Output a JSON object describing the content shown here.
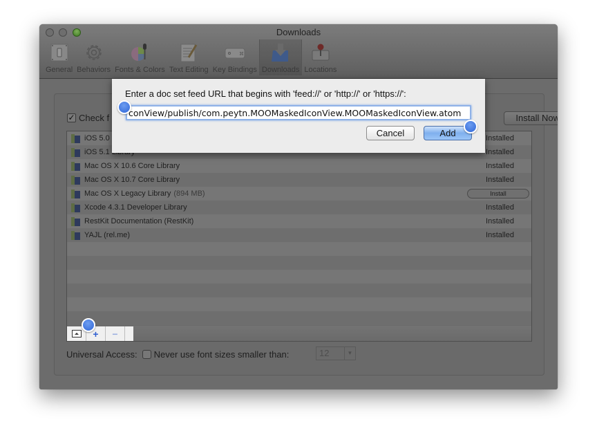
{
  "window": {
    "title": "Downloads",
    "toolbar": [
      {
        "label": "General",
        "icon": "general-switch-icon",
        "selected": false
      },
      {
        "label": "Behaviors",
        "icon": "gear-icon",
        "selected": false
      },
      {
        "label": "Fonts & Colors",
        "icon": "color-wheel-icon",
        "selected": false
      },
      {
        "label": "Text Editing",
        "icon": "document-pencil-icon",
        "selected": false
      },
      {
        "label": "Key Bindings",
        "icon": "keyboard-key-icon",
        "selected": false
      },
      {
        "label": "Downloads",
        "icon": "download-arrow-icon",
        "selected": true
      },
      {
        "label": "Locations",
        "icon": "joystick-drive-icon",
        "selected": false
      }
    ]
  },
  "downloads": {
    "check_label": "Check f",
    "check_checked": true,
    "install_now_label": "Install Now",
    "docsets": [
      {
        "name": "iOS 5.0 Library",
        "size": "",
        "status": "Installed",
        "action": false
      },
      {
        "name": "iOS 5.1 Library",
        "size": "",
        "status": "Installed",
        "action": false
      },
      {
        "name": "Mac OS X 10.6 Core Library",
        "size": "",
        "status": "Installed",
        "action": false
      },
      {
        "name": "Mac OS X 10.7 Core Library",
        "size": "",
        "status": "Installed",
        "action": false
      },
      {
        "name": "Mac OS X Legacy Library",
        "size": "(894 MB)",
        "status": "Install",
        "action": true
      },
      {
        "name": "Xcode 4.3.1 Developer Library",
        "size": "",
        "status": "Installed",
        "action": false
      },
      {
        "name": "RestKit Documentation (RestKit)",
        "size": "",
        "status": "Installed",
        "action": false
      },
      {
        "name": "YAJL (rel.me)",
        "size": "",
        "status": "Installed",
        "action": false
      }
    ],
    "list_controls": {
      "reveal_icon": "eject-triangle-icon",
      "add_label": "+",
      "remove_label": "−"
    },
    "universal_access_label": "Universal Access:",
    "min_font_label": "Never use font sizes smaller than:",
    "min_font_checked": false,
    "min_font_value": "12"
  },
  "sheet": {
    "prompt": "Enter a doc set feed URL that begins with 'feed://' or 'http://' or 'https://':",
    "url_value": "conView/publish/com.peytn.MOOMaskedIconView.MOOMaskedIconView.atom",
    "cancel_label": "Cancel",
    "add_label": "Add"
  },
  "colors": {
    "accent": "#3a6fdc",
    "default_button": "#7fb0ee",
    "focus_ring": "#8fb2e8"
  }
}
